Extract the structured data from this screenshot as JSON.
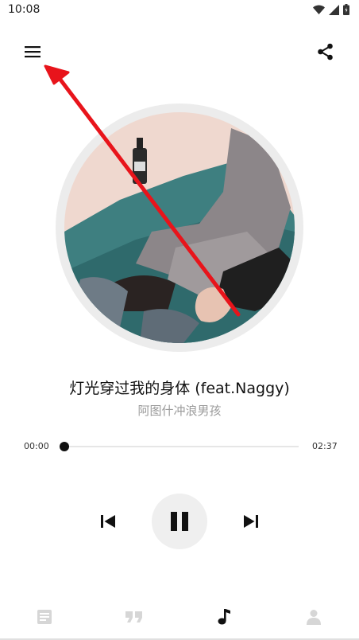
{
  "status_bar": {
    "time": "10:08",
    "icons": [
      "wifi-icon",
      "signal-icon",
      "battery-icon"
    ]
  },
  "header": {
    "menu_icon": "menu-icon",
    "share_icon": "share-icon"
  },
  "now_playing": {
    "title": "灯光穿过我的身体 (feat.Naggy)",
    "artist": "阿图什冲浪男孩",
    "current_time": "00:00",
    "total_time": "02:37",
    "progress_fraction": 0.0
  },
  "controls": {
    "previous_icon": "skip-previous-icon",
    "play_pause_icon": "pause-icon",
    "next_icon": "skip-next-icon"
  },
  "bottom_nav": {
    "items": [
      {
        "icon": "article-icon",
        "active": false
      },
      {
        "icon": "quote-icon",
        "active": false
      },
      {
        "icon": "music-note-icon",
        "active": true
      },
      {
        "icon": "person-icon",
        "active": false
      }
    ]
  },
  "colors": {
    "accent_arrow": "#e8141b",
    "active_nav": "#111111",
    "inactive_nav": "#d6d6d6",
    "artist_text": "#9a9a9a"
  }
}
